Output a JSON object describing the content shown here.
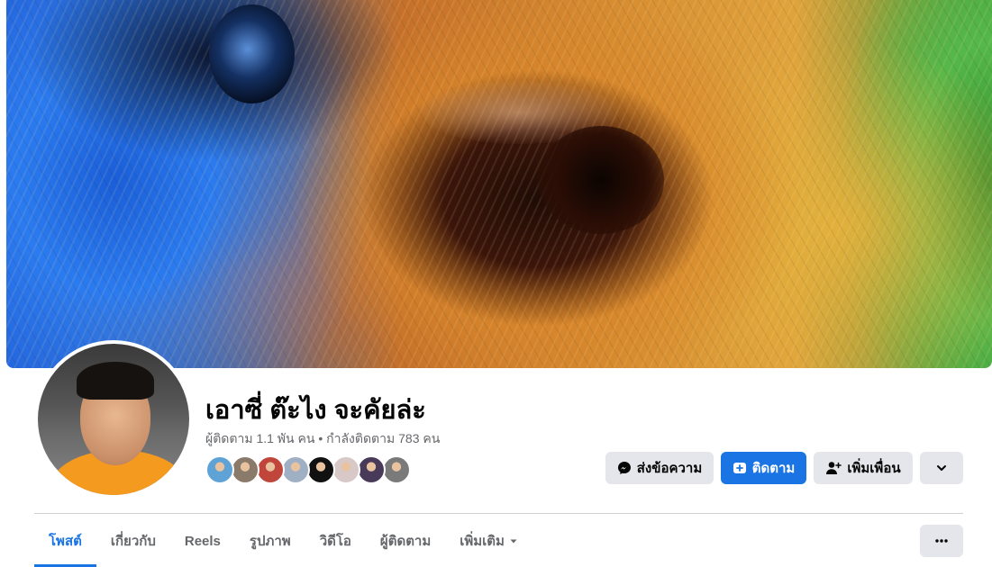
{
  "profile": {
    "name": "เอาซี่ ต๊ะไง จะคัยล่ะ",
    "followers_label": "ผู้ติดตาม 1.1 พัน คน",
    "separator": "•",
    "following_label": "กำลังติดตาม 783 คน",
    "friend_avatar_colors": [
      "#5fa3d6",
      "#8a7a6a",
      "#c0453a",
      "#9fb0c4",
      "#111111",
      "#d8c8c8",
      "#4a3a5a",
      "#7a7a7a"
    ]
  },
  "actions": {
    "message_label": "ส่งข้อความ",
    "follow_label": "ติดตาม",
    "add_friend_label": "เพิ่มเพื่อน"
  },
  "tabs": [
    {
      "label": "โพสต์",
      "active": true
    },
    {
      "label": "เกี่ยวกับ",
      "active": false
    },
    {
      "label": "Reels",
      "active": false
    },
    {
      "label": "รูปภาพ",
      "active": false
    },
    {
      "label": "วิดีโอ",
      "active": false
    },
    {
      "label": "ผู้ติดตาม",
      "active": false
    },
    {
      "label": "เพิ่มเติม",
      "active": false
    }
  ],
  "colors": {
    "accent": "#1b74e4",
    "button_grey": "#e4e6eb",
    "secondary_text": "#65676b"
  }
}
